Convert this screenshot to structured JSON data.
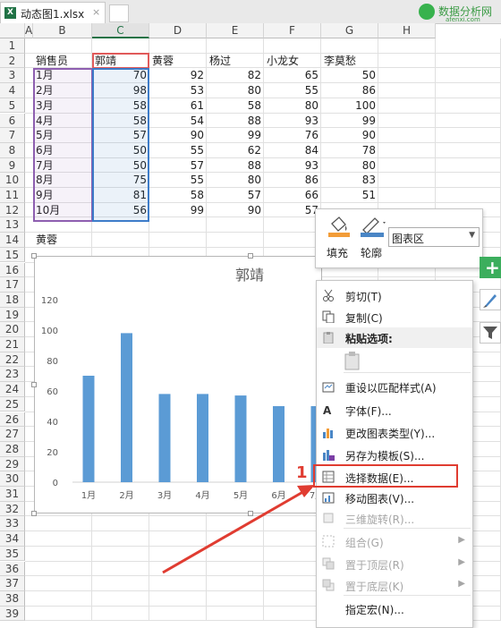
{
  "tab": {
    "filename": "动态图1.xlsx",
    "close": "×",
    "excel_icon": "X"
  },
  "logo": {
    "text": "数据分析网",
    "sub": "afenxi.com"
  },
  "columns": [
    "A",
    "B",
    "C",
    "D",
    "E",
    "F",
    "G",
    "H"
  ],
  "rows": [
    "1",
    "2",
    "3",
    "4",
    "5",
    "6",
    "7",
    "8",
    "9",
    "10",
    "11",
    "12",
    "13",
    "14",
    "15",
    "16",
    "17",
    "18",
    "19",
    "20",
    "21",
    "22",
    "23",
    "24",
    "25",
    "26",
    "27",
    "28",
    "29",
    "30",
    "31",
    "32",
    "33",
    "34",
    "35",
    "36",
    "37",
    "38",
    "39"
  ],
  "table": {
    "headers": [
      "销售员",
      "郭靖",
      "黄蓉",
      "杨过",
      "小龙女",
      "李莫愁"
    ],
    "rows": [
      [
        "1月",
        "70",
        "92",
        "82",
        "65",
        "50"
      ],
      [
        "2月",
        "98",
        "53",
        "80",
        "55",
        "86"
      ],
      [
        "3月",
        "58",
        "61",
        "58",
        "80",
        "100"
      ],
      [
        "4月",
        "58",
        "54",
        "88",
        "93",
        "99"
      ],
      [
        "5月",
        "57",
        "90",
        "99",
        "76",
        "90"
      ],
      [
        "6月",
        "50",
        "55",
        "62",
        "84",
        "78"
      ],
      [
        "7月",
        "50",
        "57",
        "88",
        "93",
        "80"
      ],
      [
        "8月",
        "75",
        "55",
        "80",
        "86",
        "83"
      ],
      [
        "9月",
        "81",
        "58",
        "57",
        "66",
        "51"
      ],
      [
        "10月",
        "56",
        "99",
        "90",
        "57",
        ""
      ]
    ]
  },
  "b14": "黄蓉",
  "chart_data": {
    "type": "bar",
    "title": "郭靖",
    "categories": [
      "1月",
      "2月",
      "3月",
      "4月",
      "5月",
      "6月",
      "7月"
    ],
    "values": [
      70,
      98,
      58,
      58,
      57,
      50,
      50
    ],
    "yticks": [
      "0",
      "20",
      "40",
      "60",
      "80",
      "100",
      "120"
    ],
    "ylim": [
      0,
      120
    ],
    "color": "#5b9bd5",
    "grid": false
  },
  "mini_toolbar": {
    "fill_label": "填充",
    "outline_label": "轮廓",
    "dropdown_value": "图表区"
  },
  "side_buttons": {
    "add": "+"
  },
  "context_menu": {
    "items": [
      {
        "label": "剪切(T)",
        "icon": "scissors-icon",
        "disabled": false
      },
      {
        "label": "复制(C)",
        "icon": "copy-icon",
        "disabled": false
      },
      {
        "label": "粘贴选项:",
        "icon": "paste-icon",
        "disabled": false
      },
      {
        "label": "重设以匹配样式(A)",
        "icon": "reset-style-icon",
        "disabled": false
      },
      {
        "label": "字体(F)...",
        "icon": "font-icon",
        "disabled": false
      },
      {
        "label": "更改图表类型(Y)...",
        "icon": "chart-type-icon",
        "disabled": false
      },
      {
        "label": "另存为模板(S)...",
        "icon": "save-template-icon",
        "disabled": false
      },
      {
        "label": "选择数据(E)...",
        "icon": "select-data-icon",
        "disabled": false
      },
      {
        "label": "移动图表(V)...",
        "icon": "move-chart-icon",
        "disabled": false
      },
      {
        "label": "三维旋转(R)...",
        "icon": "rotate-3d-icon",
        "disabled": true
      },
      {
        "label": "组合(G)",
        "icon": "group-icon",
        "disabled": true
      },
      {
        "label": "置于顶层(R)",
        "icon": "bring-front-icon",
        "disabled": true
      },
      {
        "label": "置于底层(K)",
        "icon": "send-back-icon",
        "disabled": true
      },
      {
        "label": "指定宏(N)...",
        "icon": "macro-icon",
        "disabled": false
      }
    ]
  },
  "annotation": {
    "number": "1",
    "color": "#e03c31"
  }
}
